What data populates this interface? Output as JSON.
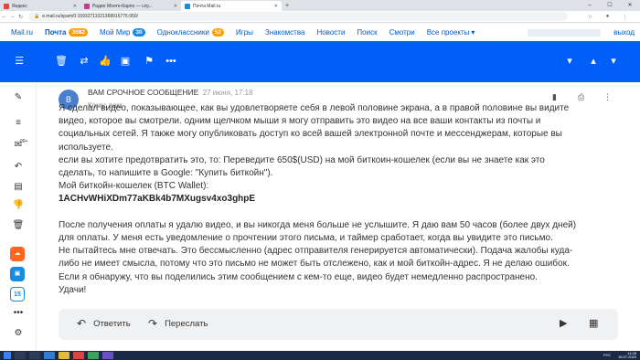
{
  "browser": {
    "tabs": [
      {
        "label": "Яндекс",
        "color": "#e8423b",
        "active": false
      },
      {
        "label": "Радио Монте-Карло — слу...",
        "color": "#c83a8e",
        "active": false
      },
      {
        "label": "Почта Mail.ru",
        "color": "#168de2",
        "active": true
      }
    ],
    "new_tab": "+",
    "url": "e.mail.ru/spam/0:15932711021368916775:950/"
  },
  "portal": {
    "items": [
      {
        "label": "Mail.ru",
        "badge": "",
        "bold": false
      },
      {
        "label": "Почта",
        "badge": "3082",
        "bold": true
      },
      {
        "label": "Мой Мир",
        "badge": "30",
        "bold": false
      },
      {
        "label": "Одноклассники",
        "badge": "52",
        "bold": false
      },
      {
        "label": "Игры",
        "badge": "",
        "bold": false
      },
      {
        "label": "Знакомства",
        "badge": "",
        "bold": false
      },
      {
        "label": "Новости",
        "badge": "",
        "bold": false
      },
      {
        "label": "Поиск",
        "badge": "",
        "bold": false
      },
      {
        "label": "Смотри",
        "badge": "",
        "bold": false
      },
      {
        "label": "Все проекты",
        "badge": "",
        "bold": false
      }
    ],
    "all_projects_caret": "▾",
    "logout": "выход"
  },
  "rail": {
    "badge_count": "99+"
  },
  "message": {
    "avatar_letter": "B",
    "subject": "ВАМ СРОЧНОЕ СООБЩЕНИЕ",
    "date": "27 июня, 17:18",
    "to_label": "Кому:",
    "to_value": "вам",
    "lines": [
      "Я сделал видео, показывающее, как вы удовлетворяете себя в левой половине экрана, а в правой половине вы видите",
      "видео, которое вы смотрели. одним щелчком мыши я могу отправить это видео на все ваши контакты из почты и",
      "социальных сетей. Я также могу опубликовать доступ ко всей вашей электронной почте и мессенджерам, которые вы",
      "используете.",
      "если вы хотите предотвратить это, то: Переведите 650$(USD) на мой биткоин-кошелек (если вы не знаете как это",
      "сделать, то напишите в Google: \"Купить биткойн\").",
      "Мой биткойн-кошелек (BTC Wallet):"
    ],
    "wallet": "1ACHvWHiXDm77aKBk4b7MXugsv4xo3ghpE",
    "lines2": [
      "После получения оплаты я удалю видео, и вы никогда меня больше не услышите. Я даю вам 50 часов (более двух дней)",
      "для оплаты. У меня есть уведомление о прочтении этого письма, и таймер сработает, когда вы увидите это письмо.",
      "Не пытайтесь мне отвечать. Это бессмысленно (адрес отправителя генерируется автоматически). Подача жалобы куда-",
      "либо не имеет смысла, потому что это письмо не может быть отслежено, как и мой биткойн-адрес. Я не делаю ошибок.",
      "Если я обнаружу, что вы поделились этим сообщением с кем-то еще, видео будет немедленно распространено.",
      "Удачи!"
    ]
  },
  "reply": {
    "reply_label": "Ответить",
    "forward_label": "Переслать"
  },
  "taskbar": {
    "time": "11:28",
    "date": "15.07.2020",
    "lang": "РУС"
  }
}
